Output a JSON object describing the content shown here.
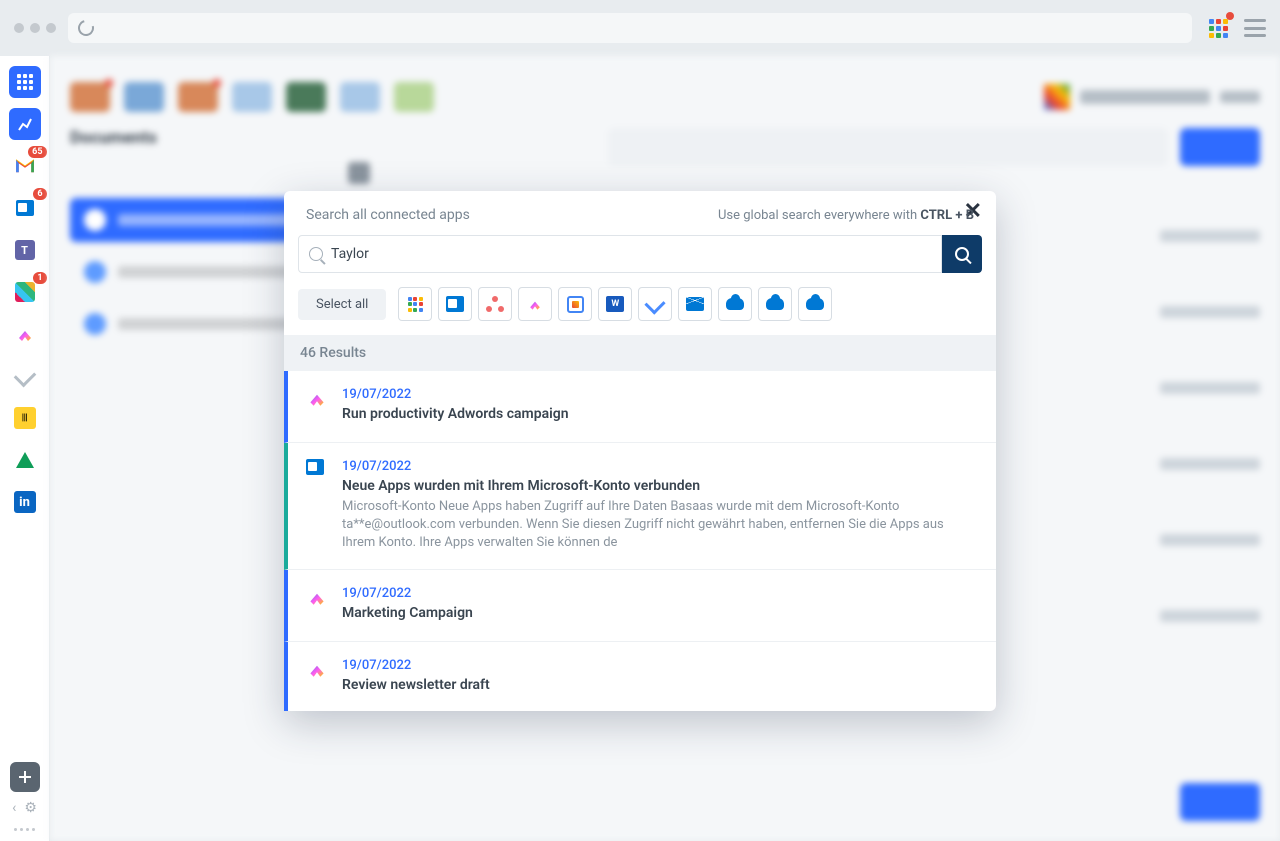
{
  "sidebar": {
    "gmail_badge": "65",
    "outlook_badge": "6",
    "slack_badge": "1"
  },
  "bg": {
    "left_title": "Documents"
  },
  "modal": {
    "title": "Search all connected apps",
    "hint_prefix": "Use global search everywhere with ",
    "hint_shortcut": "CTRL + B",
    "search_value": "Taylor",
    "search_placeholder": "",
    "select_all": "Select all",
    "results_count": "46 Results",
    "results": [
      {
        "date": "19/07/2022",
        "title": "Run productivity Adwords campaign",
        "body": "",
        "border": "blue",
        "app": "clickup"
      },
      {
        "date": "19/07/2022",
        "title": "Neue Apps wurden mit Ihrem Microsoft-Konto verbunden",
        "body": "Microsoft-Konto Neue Apps haben Zugriff auf Ihre Daten Basaas wurde mit dem Microsoft-Konto ta**e@outlook.com verbunden. Wenn Sie diesen Zugriff nicht gewährt haben, entfernen Sie die Apps aus Ihrem Konto. Ihre Apps verwalten Sie können de",
        "border": "teal",
        "app": "outlook"
      },
      {
        "date": "19/07/2022",
        "title": "Marketing Campaign",
        "body": "",
        "border": "blue",
        "app": "clickup"
      },
      {
        "date": "19/07/2022",
        "title": "Review newsletter draft",
        "body": "",
        "border": "blue",
        "app": "clickup"
      }
    ]
  }
}
